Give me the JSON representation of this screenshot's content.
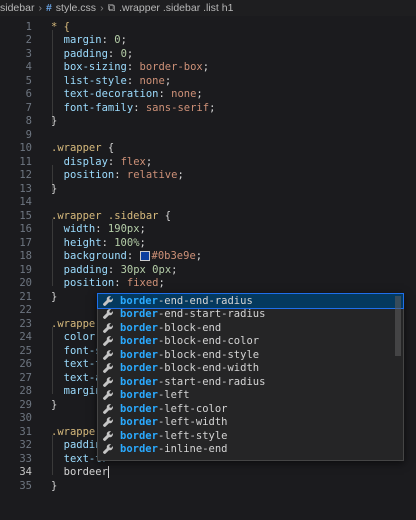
{
  "breadcrumb": {
    "folder": "sidebar",
    "file_icon": "#",
    "file": "style.css",
    "selector": ".wrapper .sidebar .list h1"
  },
  "lines": [
    {
      "n": "1",
      "parts": [
        [
          "sel",
          "* {"
        ]
      ]
    },
    {
      "n": "2",
      "parts": [
        [
          "prop",
          "  margin"
        ],
        [
          "punc",
          ": "
        ],
        [
          "num",
          "0"
        ],
        [
          "punc",
          ";"
        ]
      ]
    },
    {
      "n": "3",
      "parts": [
        [
          "prop",
          "  padding"
        ],
        [
          "punc",
          ": "
        ],
        [
          "num",
          "0"
        ],
        [
          "punc",
          ";"
        ]
      ]
    },
    {
      "n": "4",
      "parts": [
        [
          "prop",
          "  box-sizing"
        ],
        [
          "punc",
          ": "
        ],
        [
          "val",
          "border-box"
        ],
        [
          "punc",
          ";"
        ]
      ]
    },
    {
      "n": "5",
      "parts": [
        [
          "prop",
          "  list-style"
        ],
        [
          "punc",
          ": "
        ],
        [
          "val",
          "none"
        ],
        [
          "punc",
          ";"
        ]
      ]
    },
    {
      "n": "6",
      "parts": [
        [
          "prop",
          "  text-decoration"
        ],
        [
          "punc",
          ": "
        ],
        [
          "val",
          "none"
        ],
        [
          "punc",
          ";"
        ]
      ]
    },
    {
      "n": "7",
      "parts": [
        [
          "prop",
          "  font-family"
        ],
        [
          "punc",
          ": "
        ],
        [
          "val",
          "sans-serif"
        ],
        [
          "punc",
          ";"
        ]
      ]
    },
    {
      "n": "8",
      "parts": [
        [
          "brace",
          "}"
        ]
      ]
    },
    {
      "n": "9",
      "parts": []
    },
    {
      "n": "10",
      "parts": [
        [
          "sel",
          ".wrapper"
        ],
        [
          "brace",
          " {"
        ]
      ]
    },
    {
      "n": "11",
      "parts": [
        [
          "prop",
          "  display"
        ],
        [
          "punc",
          ": "
        ],
        [
          "val",
          "flex"
        ],
        [
          "punc",
          ";"
        ]
      ]
    },
    {
      "n": "12",
      "parts": [
        [
          "prop",
          "  position"
        ],
        [
          "punc",
          ": "
        ],
        [
          "val",
          "relative"
        ],
        [
          "punc",
          ";"
        ]
      ]
    },
    {
      "n": "13",
      "parts": [
        [
          "brace",
          "}"
        ]
      ]
    },
    {
      "n": "14",
      "parts": []
    },
    {
      "n": "15",
      "parts": [
        [
          "sel",
          ".wrapper .sidebar"
        ],
        [
          "brace",
          " {"
        ]
      ]
    },
    {
      "n": "16",
      "parts": [
        [
          "prop",
          "  width"
        ],
        [
          "punc",
          ": "
        ],
        [
          "num",
          "190px"
        ],
        [
          "punc",
          ";"
        ]
      ]
    },
    {
      "n": "17",
      "parts": [
        [
          "prop",
          "  height"
        ],
        [
          "punc",
          ": "
        ],
        [
          "num",
          "100%"
        ],
        [
          "punc",
          ";"
        ]
      ]
    },
    {
      "n": "18",
      "parts": [
        [
          "prop",
          "  background"
        ],
        [
          "punc",
          ": "
        ],
        [
          "swatch",
          ""
        ],
        [
          "val",
          "#0b3e9e"
        ],
        [
          "punc",
          ";"
        ]
      ]
    },
    {
      "n": "19",
      "parts": [
        [
          "prop",
          "  padding"
        ],
        [
          "punc",
          ": "
        ],
        [
          "num",
          "30px 0px"
        ],
        [
          "punc",
          ";"
        ]
      ]
    },
    {
      "n": "20",
      "parts": [
        [
          "prop",
          "  position"
        ],
        [
          "punc",
          ": "
        ],
        [
          "val",
          "fixed"
        ],
        [
          "punc",
          ";"
        ]
      ]
    },
    {
      "n": "21",
      "parts": [
        [
          "brace",
          "}"
        ]
      ]
    },
    {
      "n": "22",
      "parts": []
    },
    {
      "n": "23",
      "parts": [
        [
          "sel",
          ".wrapper"
        ]
      ]
    },
    {
      "n": "24",
      "parts": [
        [
          "prop",
          "  color"
        ],
        [
          "punc",
          ":"
        ]
      ]
    },
    {
      "n": "25",
      "parts": [
        [
          "prop",
          "  font-si"
        ]
      ]
    },
    {
      "n": "26",
      "parts": [
        [
          "prop",
          "  text-tr"
        ]
      ]
    },
    {
      "n": "27",
      "parts": [
        [
          "prop",
          "  text-al"
        ]
      ]
    },
    {
      "n": "28",
      "parts": [
        [
          "prop",
          "  margin-"
        ]
      ]
    },
    {
      "n": "29",
      "parts": [
        [
          "brace",
          "}"
        ]
      ]
    },
    {
      "n": "30",
      "parts": []
    },
    {
      "n": "31",
      "parts": [
        [
          "sel",
          ".wrapper"
        ]
      ]
    },
    {
      "n": "32",
      "parts": [
        [
          "prop",
          "  padding"
        ]
      ]
    },
    {
      "n": "33",
      "parts": [
        [
          "prop",
          "  text-tr"
        ]
      ]
    },
    {
      "n": "34",
      "parts": [
        [
          "punc",
          "  bordeer"
        ],
        [
          "cursor",
          ""
        ]
      ]
    },
    {
      "n": "35",
      "parts": [
        [
          "brace",
          "}"
        ]
      ]
    }
  ],
  "active_line": "34",
  "suggestions": [
    {
      "match": "border",
      "rest": "-end-end-radius"
    },
    {
      "match": "border",
      "rest": "-end-start-radius"
    },
    {
      "match": "border",
      "rest": "-block-end"
    },
    {
      "match": "border",
      "rest": "-block-end-color"
    },
    {
      "match": "border",
      "rest": "-block-end-style"
    },
    {
      "match": "border",
      "rest": "-block-end-width"
    },
    {
      "match": "border",
      "rest": "-start-end-radius"
    },
    {
      "match": "border",
      "rest": "-left"
    },
    {
      "match": "border",
      "rest": "-left-color"
    },
    {
      "match": "border",
      "rest": "-left-width"
    },
    {
      "match": "border",
      "rest": "-left-style"
    },
    {
      "match": "border",
      "rest": "-inline-end"
    }
  ],
  "suggestion_icon": "wrench-icon",
  "colors": {
    "background": "#1b1b1e",
    "swatch": "#0b3e9e",
    "match_highlight": "#2aaaff",
    "selected_item": "#04395e"
  }
}
